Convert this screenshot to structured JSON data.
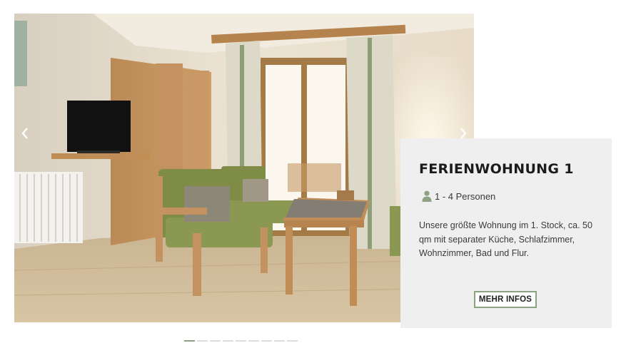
{
  "slider": {
    "image_alt": "Wohnzimmer der Ferienwohnung 1",
    "prev_icon": "chevron-left-icon",
    "next_icon": "chevron-right-icon",
    "slide_count": 9,
    "active_slide": 1
  },
  "card": {
    "title": "FERIENWOHNUNG 1",
    "persons_icon": "person-icon",
    "persons": "1 - 4 Personen",
    "description": "Unsere größte Wohnung im 1. Stock, ca. 50 qm mit separater Küche, Schlafzimmer, Wohnzimmer, Bad und Flur.",
    "button_label": "MEHR INFOS"
  },
  "colors": {
    "accent": "#8ca282",
    "card_bg": "#efefef",
    "pager_inactive": "#dddddd"
  }
}
